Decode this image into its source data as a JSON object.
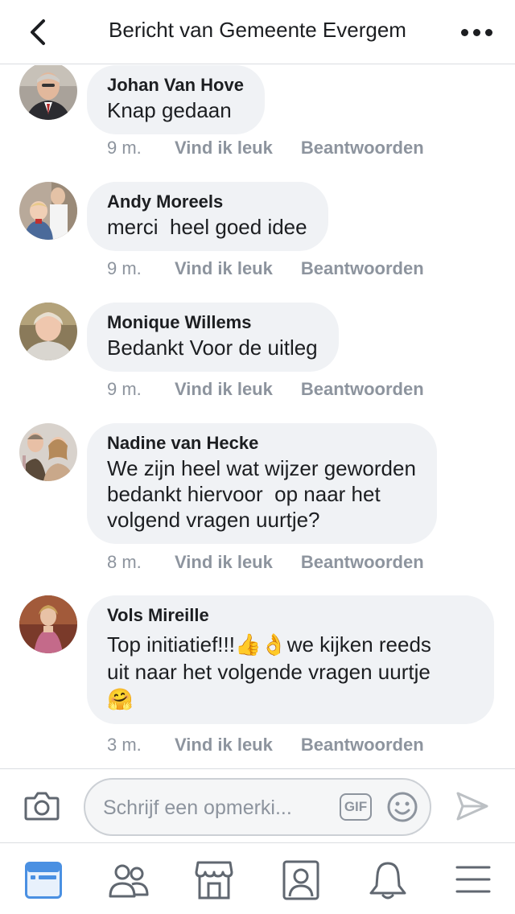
{
  "header": {
    "title": "Bericht van Gemeente Evergem",
    "back_icon": "chevron-left-icon",
    "more_icon": "more-horizontal-icon"
  },
  "comments": [
    {
      "author": "Johan Van Hove",
      "text": "Knap gedaan",
      "time": "9 m.",
      "like": "Vind ik leuk",
      "reply": "Beantwoorden"
    },
    {
      "author": "Andy Moreels",
      "text": "merci  heel goed idee",
      "time": "9 m.",
      "like": "Vind ik leuk",
      "reply": "Beantwoorden"
    },
    {
      "author": "Monique Willems",
      "text": "Bedankt Voor de uitleg",
      "time": "9 m.",
      "like": "Vind ik leuk",
      "reply": "Beantwoorden"
    },
    {
      "author": "Nadine van Hecke",
      "text": "We zijn heel wat wijzer geworden\nbedankt hiervoor  op naar het\nvolgend vragen uurtje?",
      "time": "8 m.",
      "like": "Vind ik leuk",
      "reply": "Beantwoorden"
    },
    {
      "author": "Vols Mireille",
      "text": "Top initiatief!!!👍👌we kijken reeds\nuit naar het volgende vragen uurtje\n🤗",
      "time": "3 m.",
      "like": "Vind ik leuk",
      "reply": "Beantwoorden"
    }
  ],
  "composer": {
    "placeholder": "Schrijf een opmerki...",
    "gif_label": "GIF",
    "camera_icon": "camera-icon",
    "emoji_icon": "smiley-icon",
    "send_icon": "send-icon"
  },
  "nav": {
    "items": [
      "news-feed-icon",
      "friends-icon",
      "marketplace-icon",
      "profile-icon",
      "notifications-icon",
      "menu-icon"
    ],
    "active": "news-feed-icon"
  },
  "colors": {
    "accent": "#4a90e2",
    "bubble": "#f0f2f5",
    "meta": "#8d949e"
  }
}
